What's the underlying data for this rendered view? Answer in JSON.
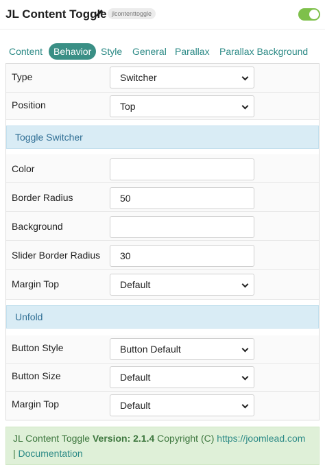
{
  "header": {
    "title": "JL Content Toggle",
    "slug": "jlcontenttoggle",
    "enabled": true
  },
  "tabs": [
    {
      "label": "Content",
      "active": false
    },
    {
      "label": "Behavior",
      "active": true
    },
    {
      "label": "Style",
      "active": false
    },
    {
      "label": "General",
      "active": false
    },
    {
      "label": "Parallax",
      "active": false
    },
    {
      "label": "Parallax Background",
      "active": false
    }
  ],
  "fields": {
    "type": {
      "label": "Type",
      "value": "Switcher"
    },
    "position": {
      "label": "Position",
      "value": "Top"
    },
    "color": {
      "label": "Color",
      "value": ""
    },
    "border_radius": {
      "label": "Border Radius",
      "value": "50"
    },
    "background": {
      "label": "Background",
      "value": ""
    },
    "slider_border_radius": {
      "label": "Slider Border Radius",
      "value": "30"
    },
    "margin_top_1": {
      "label": "Margin Top",
      "value": "Default"
    },
    "button_style": {
      "label": "Button Style",
      "value": "Button Default"
    },
    "button_size": {
      "label": "Button Size",
      "value": "Default"
    },
    "margin_top_2": {
      "label": "Margin Top",
      "value": "Default"
    }
  },
  "sections": {
    "toggle_switcher": "Toggle Switcher",
    "unfold": "Unfold"
  },
  "footer": {
    "name": "JL Content Toggle",
    "version_label": "Version:",
    "version": "2.1.4",
    "copyright": "Copyright (C)",
    "url": "https://joomlead.com",
    "separator": "|",
    "docs": "Documentation"
  },
  "colors": {
    "accent": "#3a8f85",
    "toggle_on": "#7ec04b",
    "section_bg": "#d9ecf5",
    "footer_bg": "#dff0d8"
  }
}
